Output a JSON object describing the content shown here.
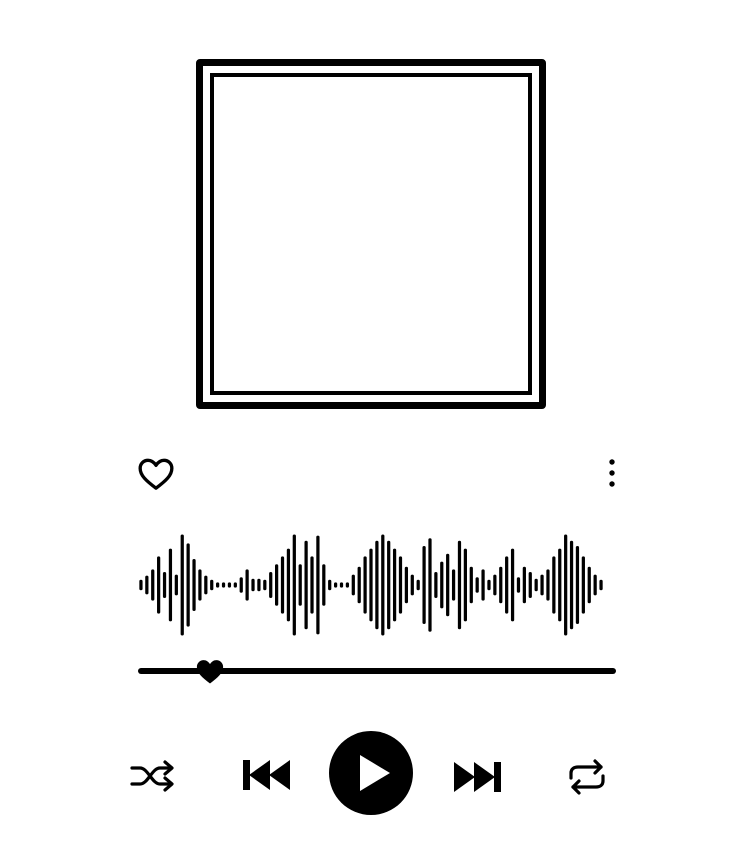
{
  "album_art": {
    "empty": true
  },
  "actions": {
    "like_icon": "heart-outline-icon",
    "more_icon": "more-vertical-icon"
  },
  "player": {
    "progress": 0.15,
    "controls": [
      "shuffle-icon",
      "previous-icon",
      "play-icon",
      "next-icon",
      "repeat-icon"
    ]
  },
  "waveform": {
    "bar_levels": [
      0.1,
      0.18,
      0.3,
      0.55,
      0.25,
      0.7,
      0.2,
      0.97,
      0.8,
      0.5,
      0.3,
      0.18,
      0.1,
      0.05,
      0.05,
      0.05,
      0.05,
      0.15,
      0.3,
      0.12,
      0.12,
      0.1,
      0.25,
      0.4,
      0.55,
      0.7,
      0.97,
      0.4,
      0.85,
      0.55,
      0.95,
      0.4,
      0.1,
      0.05,
      0.05,
      0.05,
      0.2,
      0.35,
      0.55,
      0.7,
      0.85,
      0.97,
      0.85,
      0.7,
      0.55,
      0.35,
      0.2,
      0.1,
      0.75,
      0.9,
      0.25,
      0.45,
      0.6,
      0.3,
      0.85,
      0.7,
      0.35,
      0.15,
      0.3,
      0.1,
      0.2,
      0.35,
      0.55,
      0.7,
      0.15,
      0.35,
      0.25,
      0.12,
      0.2,
      0.3,
      0.55,
      0.7,
      0.97,
      0.85,
      0.75,
      0.55,
      0.35,
      0.2,
      0.1
    ]
  }
}
